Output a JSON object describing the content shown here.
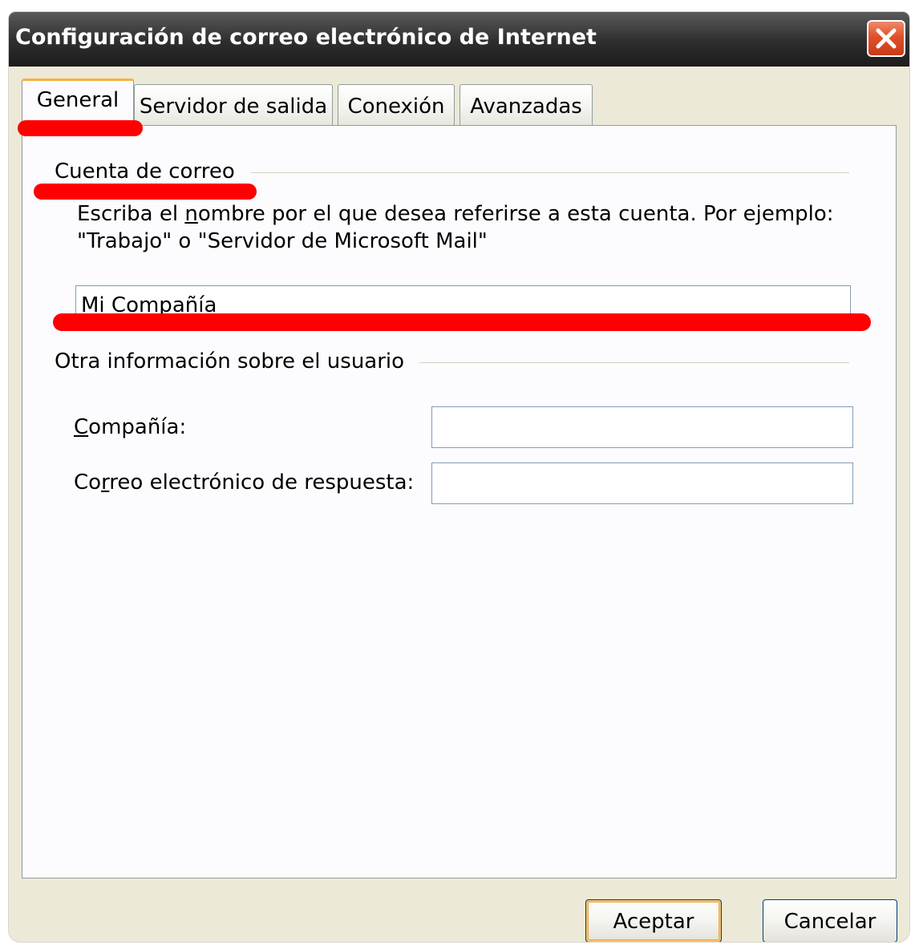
{
  "window": {
    "title": "Configuración de correo electrónico de Internet"
  },
  "tabs": [
    {
      "label": "General",
      "active": true
    },
    {
      "label": "Servidor de salida",
      "active": false
    },
    {
      "label": "Conexión",
      "active": false
    },
    {
      "label": "Avanzadas",
      "active": false
    }
  ],
  "account": {
    "group_label": "Cuenta de correo",
    "description_pre": "Escriba el ",
    "description_ul": "n",
    "description_post": "ombre por el que desea referirse a esta cuenta. Por ejemplo: \"Trabajo\" o \"Servidor de Microsoft Mail\"",
    "name_value": "Mi Compañía"
  },
  "user_info": {
    "group_label": "Otra información sobre el usuario",
    "company_label_ul": "C",
    "company_label_rest": "ompañía:",
    "company_value": "",
    "reply_label_pre": "Co",
    "reply_label_ul": "r",
    "reply_label_post": "reo electrónico de respuesta:",
    "reply_value": ""
  },
  "buttons": {
    "ok": "Aceptar",
    "cancel": "Cancelar"
  },
  "colors": {
    "annotation": "#ff0000",
    "title_bar": "#2e2e2e",
    "close_button": "#e0502a",
    "active_tab_highlight": "#f6b23c",
    "dialog_background": "#ece9d8"
  },
  "icons": {
    "close": "close-icon"
  }
}
